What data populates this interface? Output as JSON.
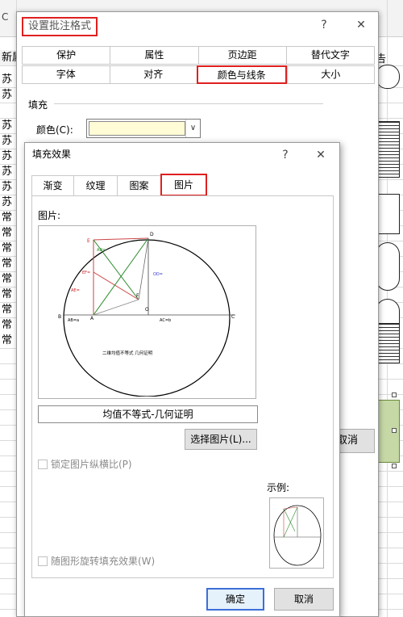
{
  "sheet": {
    "col_a_header": "新属",
    "col_a_cells": [
      "苏",
      "苏",
      "苏",
      "苏",
      "苏",
      "苏",
      "苏",
      "苏",
      "常",
      "常",
      "常",
      "常",
      "常",
      "常",
      "常",
      "常",
      "常"
    ],
    "top_left_fragment": "C",
    "top_right_fragment": "告"
  },
  "outer_dialog": {
    "title": "设置批注格式",
    "help": "?",
    "close": "✕",
    "tabs_row1": [
      "保护",
      "属性",
      "页边距",
      "替代文字"
    ],
    "tabs_row2": [
      "字体",
      "对齐",
      "颜色与线条",
      "大小"
    ],
    "active_tab": "颜色与线条",
    "fill_section": "填充",
    "color_label": "颜色(C):",
    "color_value": "#fffcd6",
    "hidden_button": "取消"
  },
  "inner_dialog": {
    "title": "填充效果",
    "help": "?",
    "close": "✕",
    "tabs": [
      "渐变",
      "纹理",
      "图案",
      "图片"
    ],
    "active_tab": "图片",
    "picture_label": "图片:",
    "caption": "均值不等式-几何证明",
    "select_picture_button": "选择图片(L)...",
    "lock_aspect_label": "锁定图片纵横比(P)",
    "sample_label": "示例:",
    "rotate_label": "随图形旋转填充效果(W)",
    "ok_button": "确定",
    "cancel_button": "取消"
  },
  "figure": {
    "caption_text": "二维均值不等式  几何证明",
    "labels": {
      "A": "A",
      "B": "B",
      "C": "C",
      "D": "D",
      "E": "E",
      "F": "F",
      "O": "O",
      "ab": "AB=a",
      "ac": "AC=b",
      "od": "OD=",
      "ae": "AE=",
      "ef": "EF=",
      "ad": "AD="
    }
  },
  "colors": {
    "accent_red": "#e02020",
    "ok_border": "#3c6fd9",
    "note_fill": "#fffcd6"
  }
}
